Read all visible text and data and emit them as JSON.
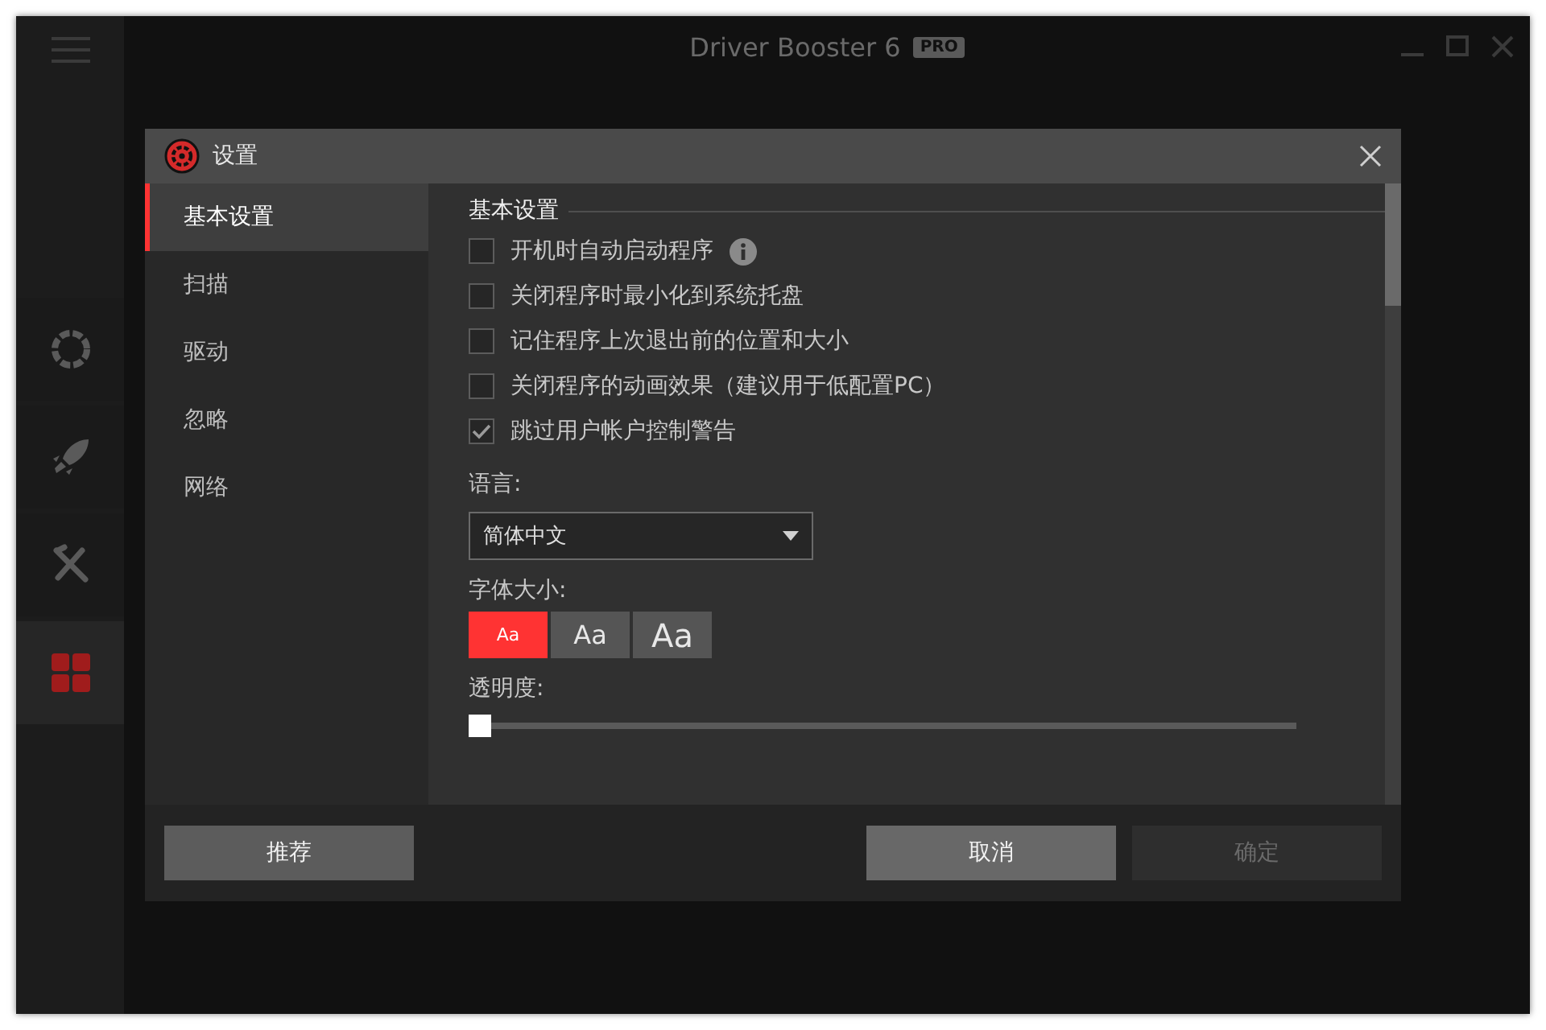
{
  "app": {
    "title": "Driver Booster 6",
    "badge": "PRO",
    "nav": [
      {
        "kind": "ring",
        "selected": false
      },
      {
        "kind": "rocket",
        "selected": false
      },
      {
        "kind": "tools",
        "selected": false
      },
      {
        "kind": "grid",
        "selected": true
      }
    ]
  },
  "dialog": {
    "title": "设置",
    "tabs": [
      {
        "label": "基本设置",
        "selected": true
      },
      {
        "label": "扫描",
        "selected": false
      },
      {
        "label": "驱动",
        "selected": false
      },
      {
        "label": "忽略",
        "selected": false
      },
      {
        "label": "网络",
        "selected": false
      }
    ],
    "section_title": "基本设置",
    "options": [
      {
        "label": "开机时自动启动程序",
        "checked": false,
        "info": true
      },
      {
        "label": "关闭程序时最小化到系统托盘",
        "checked": false,
        "info": false
      },
      {
        "label": "记住程序上次退出前的位置和大小",
        "checked": false,
        "info": false
      },
      {
        "label": "关闭程序的动画效果（建议用于低配置PC）",
        "checked": false,
        "info": false
      },
      {
        "label": "跳过用户帐户控制警告",
        "checked": true,
        "info": false
      }
    ],
    "language_label": "语言:",
    "language_value": "简体中文",
    "font_size_label": "字体大小:",
    "font_sizes": [
      {
        "label": "Aa",
        "kind": "small",
        "selected": true
      },
      {
        "label": "Aa",
        "kind": "medium",
        "selected": false
      },
      {
        "label": "Aa",
        "kind": "large",
        "selected": false
      }
    ],
    "opacity_label": "透明度:",
    "opacity": {
      "level": 0
    },
    "buttons": [
      {
        "label": "推荐",
        "kind": "left",
        "disabled": false
      },
      {
        "label": "取消",
        "kind": "right",
        "disabled": false
      },
      {
        "label": "确定",
        "kind": "right",
        "disabled": true
      }
    ]
  }
}
